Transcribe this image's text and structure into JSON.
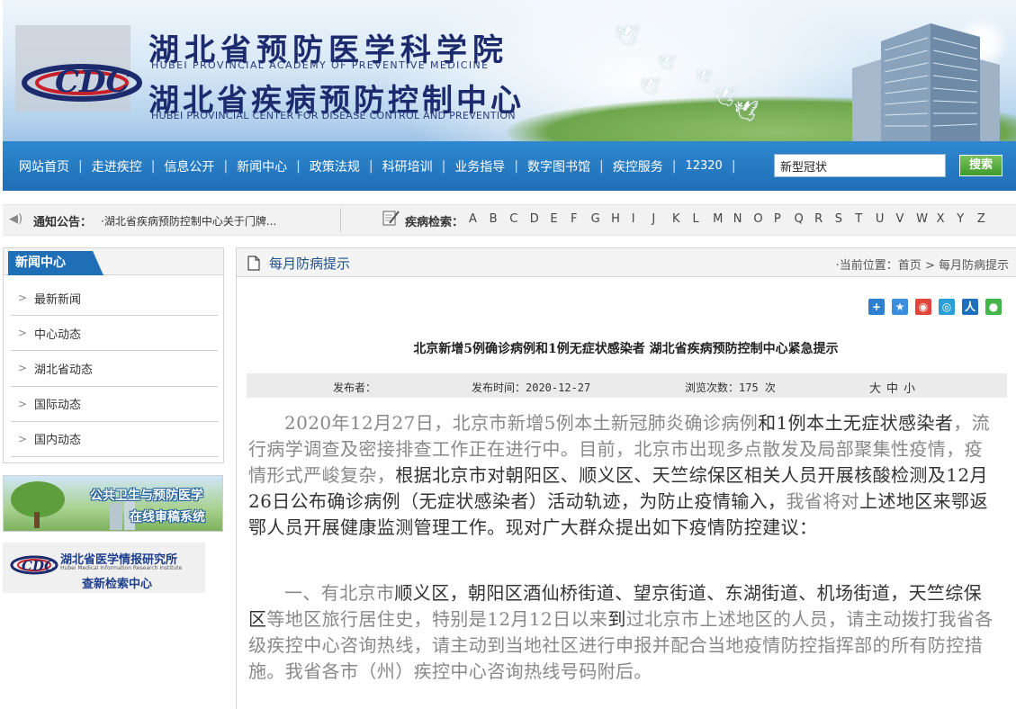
{
  "header": {
    "title_cn_1": "湖北省预防医学科学院",
    "title_en_1": "HUBEI PROVINCIAL ACADEMY OF PREVENTIVE MEDICINE",
    "title_cn_2": "湖北省疾病预防控制中心",
    "title_en_2": "HUBEI PROVINCIAL CENTER FOR DISEASE CONTROL AND PREVENTION",
    "logo_text": "CDC"
  },
  "nav": {
    "items": [
      {
        "label": "网站首页"
      },
      {
        "label": "走进疾控"
      },
      {
        "label": "信息公开"
      },
      {
        "label": "新闻中心"
      },
      {
        "label": "政策法规"
      },
      {
        "label": "科研培训"
      },
      {
        "label": "业务指导"
      },
      {
        "label": "数字图书馆"
      },
      {
        "label": "疾控服务"
      },
      {
        "label": "12320"
      }
    ],
    "separator": "|",
    "search_value": "新型冠状",
    "search_button": "搜索"
  },
  "notice": {
    "label": "通知公告：",
    "text": "·湖北省疾病预防控制中心关于门牌...",
    "disease_label": "疾病检索：",
    "letters": [
      "A",
      "B",
      "C",
      "D",
      "E",
      "F",
      "G",
      "H",
      "I",
      "J",
      "K",
      "L",
      "M",
      "N",
      "O",
      "P",
      "Q",
      "R",
      "S",
      "T",
      "U",
      "V",
      "W",
      "X",
      "Y",
      "Z"
    ]
  },
  "sidebar": {
    "title": "新闻中心",
    "items": [
      {
        "label": "最新新闻"
      },
      {
        "label": "中心动态"
      },
      {
        "label": "湖北省动态"
      },
      {
        "label": "国际动态"
      },
      {
        "label": "国内动态"
      }
    ],
    "promo1_line1": "公共卫生与预防医学",
    "promo1_line2": "在线审稿系统",
    "promo2_line1": "湖北省医学情报研究所",
    "promo2_line2": "Hubei Medical Information Research Institute",
    "promo2_line3": "查新检索中心"
  },
  "main": {
    "section_title": "每月防病提示",
    "crumb_prefix": "·当前位置：",
    "crumb_home": "首页",
    "crumb_sep": " > ",
    "crumb_current": "每月防病提示",
    "article_title": "北京新增5例确诊病例和1例无症状感染者  湖北省疾病预防控制中心紧急提示",
    "meta_publisher": "发布者：",
    "meta_time": "发布时间：2020-12-27",
    "meta_views": "浏览次数：175 次",
    "font_large": "大",
    "font_mid": "中",
    "font_small": "小",
    "p1_a": "2020年12月27日，北京市新增5例本土新冠肺炎确诊病例",
    "p1_b": "和1例本土无症状感染者",
    "p1_c": "，流行病学调查及密接排查工作正在进行中。目前，北京市出现多点散发及局部聚集性疫情，疫情形式严峻复杂，",
    "p1_d": "根据北京市对朝阳区、顺义区、天竺综保区相关人员开展核酸检测及12月26日公布确诊病例（无症状感染者）活动轨迹，为防止疫情输入，",
    "p1_e": "我省将对",
    "p1_f": "上述地区来鄂返鄂人员开展健康监测管理工作。现对广大群众提出如下疫情防控建议：",
    "p2_a": "一、有北京市",
    "p2_b": "顺义区，朝阳区酒仙桥街道、望京街道、东湖街道、机场街道，天竺综保区",
    "p2_c": "等地区旅行居住史，特别是12月12日以来",
    "p2_d": "到",
    "p2_e": "过北京市上述地区的人员，请主动拨打我省各级疾控中心咨询热线，请主动到当地社区进行申报并配合当地疫情防控指挥部的所有防控措施。我省各市（州）疾控中心咨询热线号码附后。"
  },
  "colors": {
    "nav_blue": "#1f6fb7",
    "title_navy": "#1c2b6e",
    "search_green": "#3f9a2a"
  },
  "icons": [
    "speaker-icon",
    "pen-notebook-icon",
    "chevron-right-icon",
    "document-icon",
    "share-plus-icon",
    "share-qzone-icon",
    "share-weibo-icon",
    "share-tqq-icon",
    "share-renren-icon",
    "share-wechat-icon"
  ]
}
